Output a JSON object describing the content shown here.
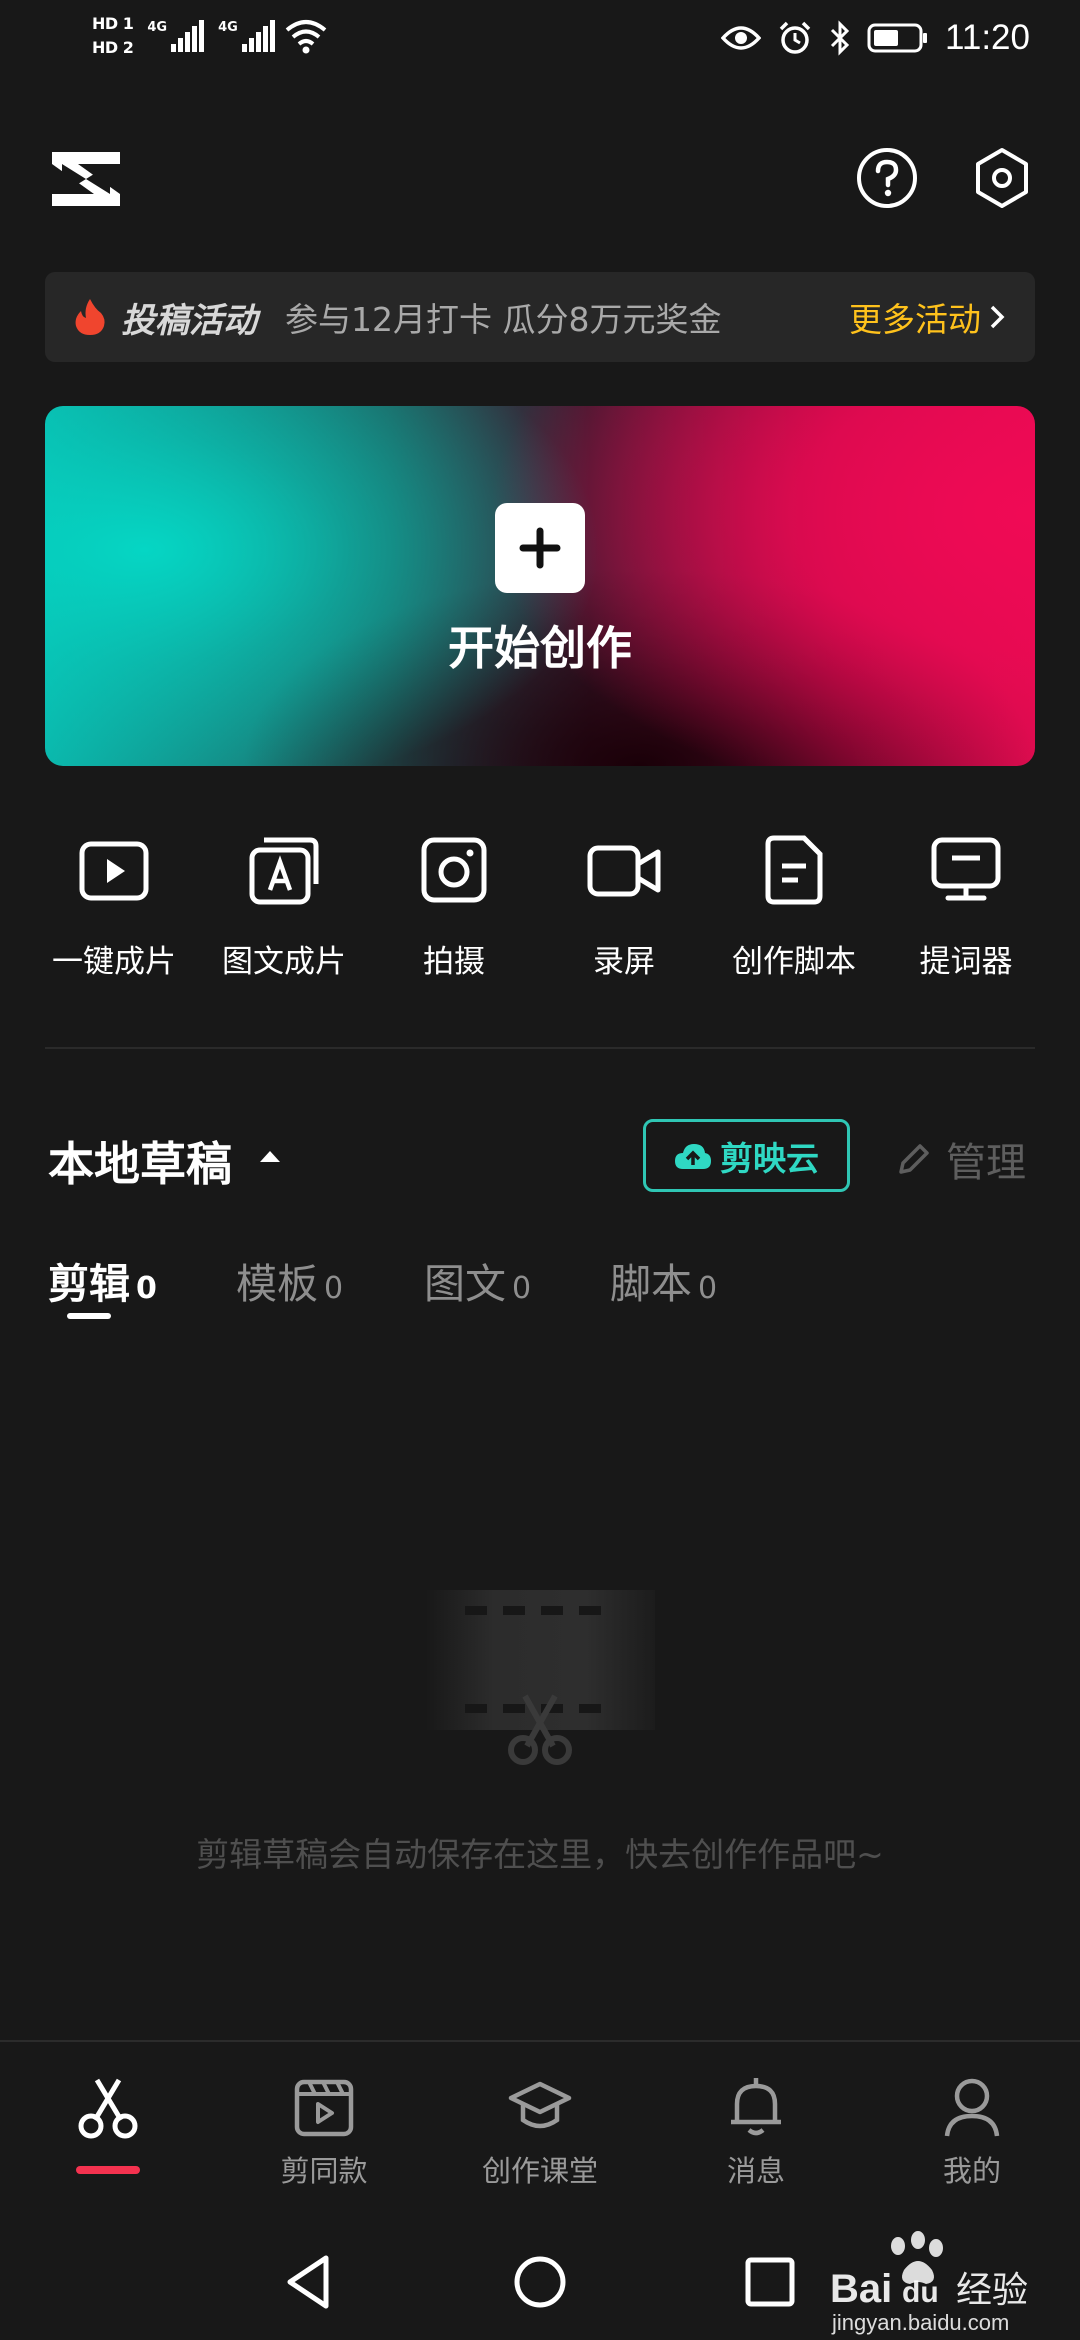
{
  "status_bar": {
    "hd1": "HD 1",
    "hd2": "HD 2",
    "net1": "4G",
    "net2": "4G",
    "time": "11:20"
  },
  "header": {
    "logo_icon": "capcut-logo-icon",
    "help_icon": "question-icon",
    "settings_icon": "hexagon-settings-icon"
  },
  "banner": {
    "title": "投稿活动",
    "desc": "参与12月打卡 瓜分8万元奖金",
    "more": "更多活动"
  },
  "hero": {
    "label": "开始创作"
  },
  "tools": [
    {
      "label": "一键成片",
      "icon": "play-square-icon"
    },
    {
      "label": "图文成片",
      "icon": "text-to-video-icon"
    },
    {
      "label": "拍摄",
      "icon": "camera-icon"
    },
    {
      "label": "录屏",
      "icon": "video-camera-icon"
    },
    {
      "label": "创作脚本",
      "icon": "script-doc-icon"
    },
    {
      "label": "提词器",
      "icon": "teleprompter-icon"
    }
  ],
  "drafts": {
    "title": "本地草稿",
    "cloud_button": "剪映云",
    "manage": "管理",
    "tabs": [
      {
        "name": "剪辑",
        "count": "0"
      },
      {
        "name": "模板",
        "count": "0"
      },
      {
        "name": "图文",
        "count": "0"
      },
      {
        "name": "脚本",
        "count": "0"
      }
    ],
    "active_tab": "剪辑",
    "empty_text": "剪辑草稿会自动保存在这里，快去创作作品吧~"
  },
  "bottom_nav": [
    {
      "label": "",
      "icon": "scissors-icon",
      "active": true
    },
    {
      "label": "剪同款",
      "icon": "template-clapper-icon"
    },
    {
      "label": "创作课堂",
      "icon": "graduation-cap-icon"
    },
    {
      "label": "消息",
      "icon": "bell-icon"
    },
    {
      "label": "我的",
      "icon": "profile-icon"
    }
  ],
  "watermark": {
    "brand": "Bai du 经验",
    "url": "jingyan.baidu.com"
  },
  "colors": {
    "background": "#181818",
    "accent_yellow": "#ffc21c",
    "accent_teal": "#2fd8c3",
    "accent_red": "#f4324f"
  }
}
